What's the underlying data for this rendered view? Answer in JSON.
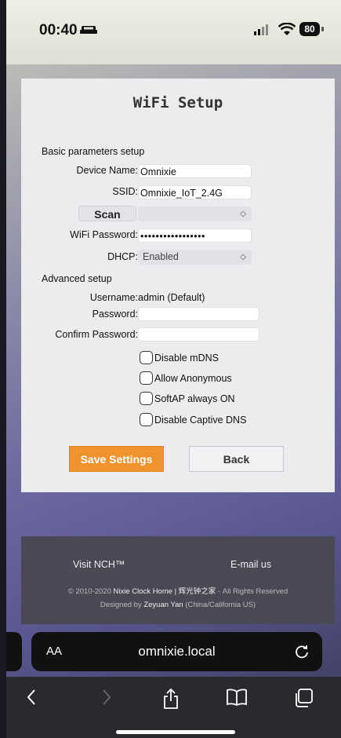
{
  "status": {
    "time": "00:40",
    "battery": "80"
  },
  "page": {
    "title": "WiFi Setup",
    "basic_heading": "Basic parameters setup",
    "device_name_label": "Device Name:",
    "device_name_value": "Omnixie",
    "ssid_label": "SSID:",
    "ssid_value": "Omnixie_IoT_2.4G",
    "scan_label": "Scan",
    "scan_select_value": "",
    "wifi_password_label": "WiFi Password:",
    "wifi_password_value": "•••••••••••••••••",
    "dhcp_label": "DHCP:",
    "dhcp_value": "Enabled",
    "advanced_heading": "Advanced setup",
    "username_label": "Username:",
    "username_value": "admin (Default)",
    "password_label": "Password:",
    "confirm_password_label": "Confirm Password:",
    "checkboxes": [
      {
        "label": "Disable mDNS",
        "checked": false
      },
      {
        "label": "Allow Anonymous",
        "checked": false
      },
      {
        "label": "SoftAP always ON",
        "checked": false
      },
      {
        "label": "Disable Captive DNS",
        "checked": false
      }
    ],
    "save_label": "Save Settings",
    "back_label": "Back"
  },
  "footer": {
    "visit_label": "Visit NCH™",
    "email_label": "E-mail us",
    "copyright_prefix": "© 2010-2020",
    "copyright_site": "Nixie Clock Home | 辉光钟之家",
    "copyright_suffix": "- All Rights Reserved",
    "designed_prefix": "Designed by",
    "designer": "Zeyuan Yan",
    "designer_location": "(China/California US)"
  },
  "browser": {
    "aa_label": "AA",
    "url": "omnixie.local"
  },
  "colors": {
    "accent": "#f0922d",
    "footer_bg": "#4a4855"
  }
}
